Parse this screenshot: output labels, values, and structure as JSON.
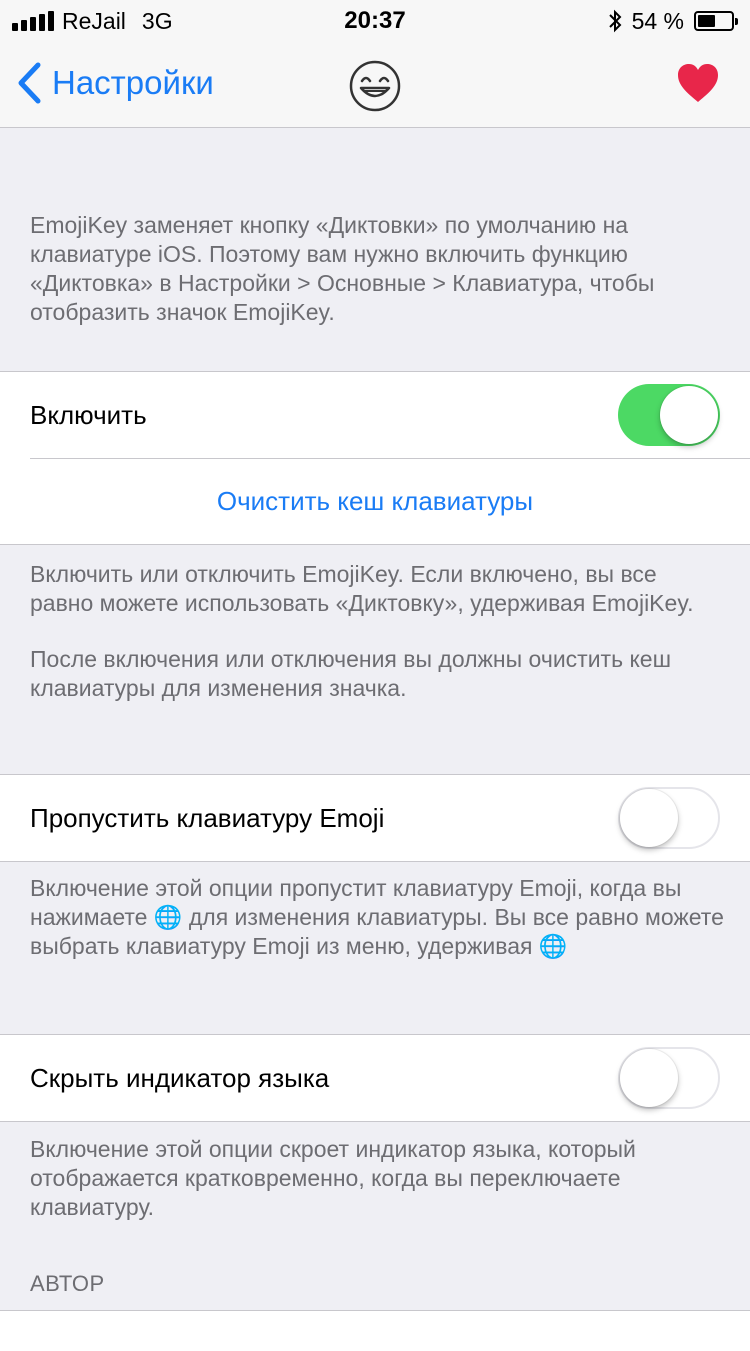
{
  "status_bar": {
    "carrier": "ReJail",
    "network": "3G",
    "time": "20:37",
    "battery_percent_label": "54 %",
    "battery_level": 0.54
  },
  "nav": {
    "back_label": "Настройки",
    "logo_icon": "grinning-face-icon",
    "heart_icon": "heart-icon",
    "heart_color": "#e8264a",
    "accent_color": "#1a7cf5"
  },
  "intro_text": "EmojiKey заменяет кнопку «Диктовки» по умолчанию на клавиатуре iOS. Поэтому вам нужно включить функцию «Диктовка» в Настройки > Основные > Клавиатура, чтобы отобразить значок EmojiKey.",
  "enable_group": {
    "enable_label": "Включить",
    "enable_on": true,
    "clear_cache_label": "Очистить кеш клавиатуры"
  },
  "enable_footer": {
    "p1": "Включить или отключить EmojiKey. Если включено, вы все равно можете использовать «Диктовку», удерживая EmojiKey.",
    "p2": "После включения или отключения вы должны очистить кеш клавиатуры для изменения значка."
  },
  "skip_group": {
    "label": "Пропустить клавиатуру Emoji",
    "on": false
  },
  "skip_footer": {
    "part1": "Включение этой опции пропустит клавиатуру Emoji, когда вы нажимаете",
    "globe1": "🌐",
    "part2": "для изменения клавиатуры. Вы все равно можете выбрать клавиатуру Emoji из меню, удерживая",
    "globe2": "🌐"
  },
  "hide_group": {
    "label": "Скрыть индикатор языка",
    "on": false
  },
  "hide_footer": "Включение этой опции скроет индикатор языка, который отображается кратковременно, когда вы переключаете клавиатуру.",
  "author_header": "АВТОР",
  "toggle_on_color": "#4cd964"
}
